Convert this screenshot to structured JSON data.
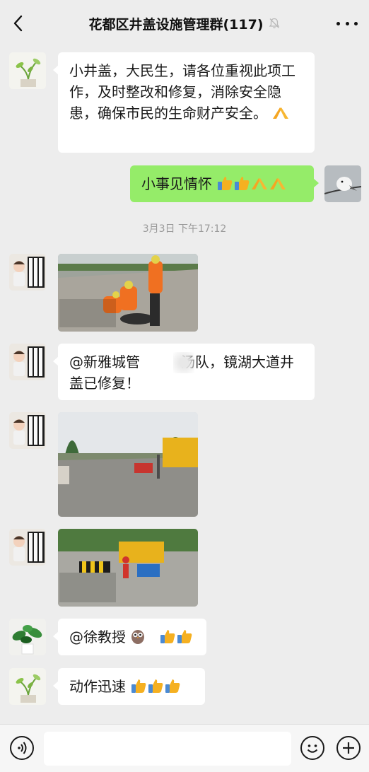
{
  "header": {
    "title": "花都区井盖设施管理群(117)"
  },
  "messages": [
    {
      "text": "小井盖，大民生，请各位重视此项工作，及时整改和修复，消除安全隐患，确保市民的生命财产安全。"
    },
    {
      "text": "小事见情怀"
    },
    {
      "timestamp": "3月3日 下午17:12"
    },
    {
      "mention": "@新雅城管",
      "mention_tail": "汤队，镜湖大道井盖已修复！"
    },
    {
      "text": "@徐教授"
    },
    {
      "text": "动作迅速"
    }
  ],
  "input": {
    "placeholder": ""
  },
  "icons": {
    "back": "chevron-left-icon",
    "mute": "bell-off-icon",
    "more": "more-dots-icon",
    "voice": "voice-icon",
    "emoji": "emoji-icon",
    "plus": "plus-icon"
  },
  "colors": {
    "background": "#ededed",
    "own_bubble": "#95ec69",
    "other_bubble": "#ffffff"
  }
}
